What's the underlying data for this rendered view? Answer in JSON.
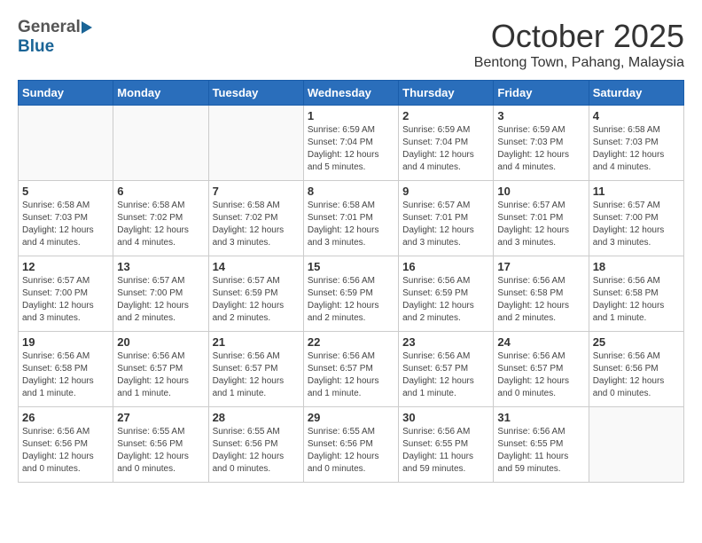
{
  "logo": {
    "general": "General",
    "blue": "Blue"
  },
  "title": "October 2025",
  "location": "Bentong Town, Pahang, Malaysia",
  "weekdays": [
    "Sunday",
    "Monday",
    "Tuesday",
    "Wednesday",
    "Thursday",
    "Friday",
    "Saturday"
  ],
  "days": [
    {
      "date": "",
      "info": ""
    },
    {
      "date": "",
      "info": ""
    },
    {
      "date": "",
      "info": ""
    },
    {
      "date": "1",
      "info": "Sunrise: 6:59 AM\nSunset: 7:04 PM\nDaylight: 12 hours\nand 5 minutes."
    },
    {
      "date": "2",
      "info": "Sunrise: 6:59 AM\nSunset: 7:04 PM\nDaylight: 12 hours\nand 4 minutes."
    },
    {
      "date": "3",
      "info": "Sunrise: 6:59 AM\nSunset: 7:03 PM\nDaylight: 12 hours\nand 4 minutes."
    },
    {
      "date": "4",
      "info": "Sunrise: 6:58 AM\nSunset: 7:03 PM\nDaylight: 12 hours\nand 4 minutes."
    },
    {
      "date": "5",
      "info": "Sunrise: 6:58 AM\nSunset: 7:03 PM\nDaylight: 12 hours\nand 4 minutes."
    },
    {
      "date": "6",
      "info": "Sunrise: 6:58 AM\nSunset: 7:02 PM\nDaylight: 12 hours\nand 4 minutes."
    },
    {
      "date": "7",
      "info": "Sunrise: 6:58 AM\nSunset: 7:02 PM\nDaylight: 12 hours\nand 3 minutes."
    },
    {
      "date": "8",
      "info": "Sunrise: 6:58 AM\nSunset: 7:01 PM\nDaylight: 12 hours\nand 3 minutes."
    },
    {
      "date": "9",
      "info": "Sunrise: 6:57 AM\nSunset: 7:01 PM\nDaylight: 12 hours\nand 3 minutes."
    },
    {
      "date": "10",
      "info": "Sunrise: 6:57 AM\nSunset: 7:01 PM\nDaylight: 12 hours\nand 3 minutes."
    },
    {
      "date": "11",
      "info": "Sunrise: 6:57 AM\nSunset: 7:00 PM\nDaylight: 12 hours\nand 3 minutes."
    },
    {
      "date": "12",
      "info": "Sunrise: 6:57 AM\nSunset: 7:00 PM\nDaylight: 12 hours\nand 3 minutes."
    },
    {
      "date": "13",
      "info": "Sunrise: 6:57 AM\nSunset: 7:00 PM\nDaylight: 12 hours\nand 2 minutes."
    },
    {
      "date": "14",
      "info": "Sunrise: 6:57 AM\nSunset: 6:59 PM\nDaylight: 12 hours\nand 2 minutes."
    },
    {
      "date": "15",
      "info": "Sunrise: 6:56 AM\nSunset: 6:59 PM\nDaylight: 12 hours\nand 2 minutes."
    },
    {
      "date": "16",
      "info": "Sunrise: 6:56 AM\nSunset: 6:59 PM\nDaylight: 12 hours\nand 2 minutes."
    },
    {
      "date": "17",
      "info": "Sunrise: 6:56 AM\nSunset: 6:58 PM\nDaylight: 12 hours\nand 2 minutes."
    },
    {
      "date": "18",
      "info": "Sunrise: 6:56 AM\nSunset: 6:58 PM\nDaylight: 12 hours\nand 1 minute."
    },
    {
      "date": "19",
      "info": "Sunrise: 6:56 AM\nSunset: 6:58 PM\nDaylight: 12 hours\nand 1 minute."
    },
    {
      "date": "20",
      "info": "Sunrise: 6:56 AM\nSunset: 6:57 PM\nDaylight: 12 hours\nand 1 minute."
    },
    {
      "date": "21",
      "info": "Sunrise: 6:56 AM\nSunset: 6:57 PM\nDaylight: 12 hours\nand 1 minute."
    },
    {
      "date": "22",
      "info": "Sunrise: 6:56 AM\nSunset: 6:57 PM\nDaylight: 12 hours\nand 1 minute."
    },
    {
      "date": "23",
      "info": "Sunrise: 6:56 AM\nSunset: 6:57 PM\nDaylight: 12 hours\nand 1 minute."
    },
    {
      "date": "24",
      "info": "Sunrise: 6:56 AM\nSunset: 6:57 PM\nDaylight: 12 hours\nand 0 minutes."
    },
    {
      "date": "25",
      "info": "Sunrise: 6:56 AM\nSunset: 6:56 PM\nDaylight: 12 hours\nand 0 minutes."
    },
    {
      "date": "26",
      "info": "Sunrise: 6:56 AM\nSunset: 6:56 PM\nDaylight: 12 hours\nand 0 minutes."
    },
    {
      "date": "27",
      "info": "Sunrise: 6:55 AM\nSunset: 6:56 PM\nDaylight: 12 hours\nand 0 minutes."
    },
    {
      "date": "28",
      "info": "Sunrise: 6:55 AM\nSunset: 6:56 PM\nDaylight: 12 hours\nand 0 minutes."
    },
    {
      "date": "29",
      "info": "Sunrise: 6:55 AM\nSunset: 6:56 PM\nDaylight: 12 hours\nand 0 minutes."
    },
    {
      "date": "30",
      "info": "Sunrise: 6:56 AM\nSunset: 6:55 PM\nDaylight: 11 hours\nand 59 minutes."
    },
    {
      "date": "31",
      "info": "Sunrise: 6:56 AM\nSunset: 6:55 PM\nDaylight: 11 hours\nand 59 minutes."
    },
    {
      "date": "",
      "info": ""
    }
  ]
}
